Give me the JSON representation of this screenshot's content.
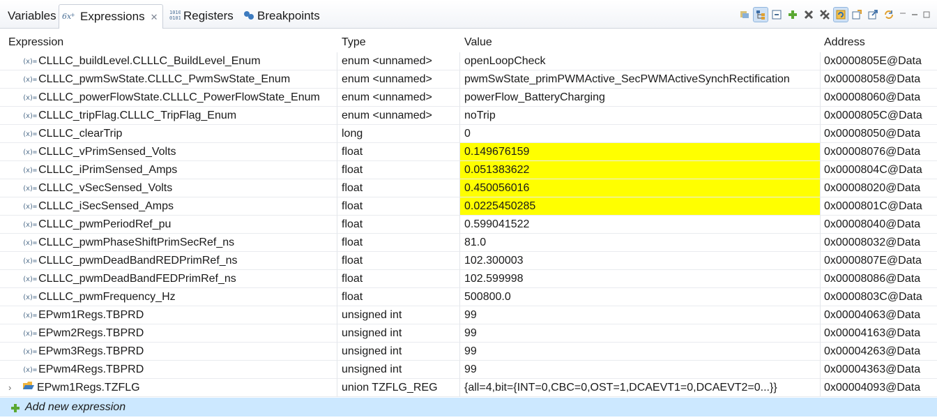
{
  "tabs": [
    {
      "label": "Variables",
      "active": false
    },
    {
      "label": "Expressions",
      "active": true
    },
    {
      "label": "Registers",
      "active": false
    },
    {
      "label": "Breakpoints",
      "active": false
    }
  ],
  "columns": {
    "expression": "Expression",
    "type": "Type",
    "value": "Value",
    "address": "Address"
  },
  "rows": [
    {
      "expression": "CLLLC_buildLevel.CLLLC_BuildLevel_Enum",
      "type": "enum <unnamed>",
      "value": "openLoopCheck",
      "address": "0x0000805E@Data",
      "highlighted": false
    },
    {
      "expression": "CLLLC_pwmSwState.CLLLC_PwmSwState_Enum",
      "type": "enum <unnamed>",
      "value": "pwmSwState_primPWMActive_SecPWMActiveSynchRectification",
      "address": "0x00008058@Data",
      "highlighted": false
    },
    {
      "expression": "CLLLC_powerFlowState.CLLLC_PowerFlowState_Enum",
      "type": "enum <unnamed>",
      "value": "powerFlow_BatteryCharging",
      "address": "0x00008060@Data",
      "highlighted": false
    },
    {
      "expression": "CLLLC_tripFlag.CLLLC_TripFlag_Enum",
      "type": "enum <unnamed>",
      "value": "noTrip",
      "address": "0x0000805C@Data",
      "highlighted": false
    },
    {
      "expression": "CLLLC_clearTrip",
      "type": "long",
      "value": "0",
      "address": "0x00008050@Data",
      "highlighted": false
    },
    {
      "expression": "CLLLC_vPrimSensed_Volts",
      "type": "float",
      "value": "0.149676159",
      "address": "0x00008076@Data",
      "highlighted": true
    },
    {
      "expression": "CLLLC_iPrimSensed_Amps",
      "type": "float",
      "value": "0.051383622",
      "address": "0x0000804C@Data",
      "highlighted": true
    },
    {
      "expression": "CLLLC_vSecSensed_Volts",
      "type": "float",
      "value": "0.450056016",
      "address": "0x00008020@Data",
      "highlighted": true
    },
    {
      "expression": "CLLLC_iSecSensed_Amps",
      "type": "float",
      "value": "0.0225450285",
      "address": "0x0000801C@Data",
      "highlighted": true
    },
    {
      "expression": "CLLLC_pwmPeriodRef_pu",
      "type": "float",
      "value": "0.599041522",
      "address": "0x00008040@Data",
      "highlighted": false
    },
    {
      "expression": "CLLLC_pwmPhaseShiftPrimSecRef_ns",
      "type": "float",
      "value": "81.0",
      "address": "0x00008032@Data",
      "highlighted": false
    },
    {
      "expression": "CLLLC_pwmDeadBandREDPrimRef_ns",
      "type": "float",
      "value": "102.300003",
      "address": "0x0000807E@Data",
      "highlighted": false
    },
    {
      "expression": "CLLLC_pwmDeadBandFEDPrimRef_ns",
      "type": "float",
      "value": "102.599998",
      "address": "0x00008086@Data",
      "highlighted": false
    },
    {
      "expression": "CLLLC_pwmFrequency_Hz",
      "type": "float",
      "value": "500800.0",
      "address": "0x0000803C@Data",
      "highlighted": false
    },
    {
      "expression": "EPwm1Regs.TBPRD",
      "type": "unsigned int",
      "value": "99",
      "address": "0x00004063@Data",
      "highlighted": false
    },
    {
      "expression": "EPwm2Regs.TBPRD",
      "type": "unsigned int",
      "value": "99",
      "address": "0x00004163@Data",
      "highlighted": false
    },
    {
      "expression": "EPwm3Regs.TBPRD",
      "type": "unsigned int",
      "value": "99",
      "address": "0x00004263@Data",
      "highlighted": false
    },
    {
      "expression": "EPwm4Regs.TBPRD",
      "type": "unsigned int",
      "value": "99",
      "address": "0x00004363@Data",
      "highlighted": false
    },
    {
      "expression": "EPwm1Regs.TZFLG",
      "type": "union TZFLG_REG",
      "value": "{all=4,bit={INT=0,CBC=0,OST=1,DCAEVT1=0,DCAEVT2=0...}}",
      "address": "0x00004093@Data",
      "highlighted": false,
      "expandable": true
    }
  ],
  "add_expression_label": "Add new expression",
  "colors": {
    "highlight": "#ffff00",
    "add_row_bg": "#cce8ff"
  }
}
